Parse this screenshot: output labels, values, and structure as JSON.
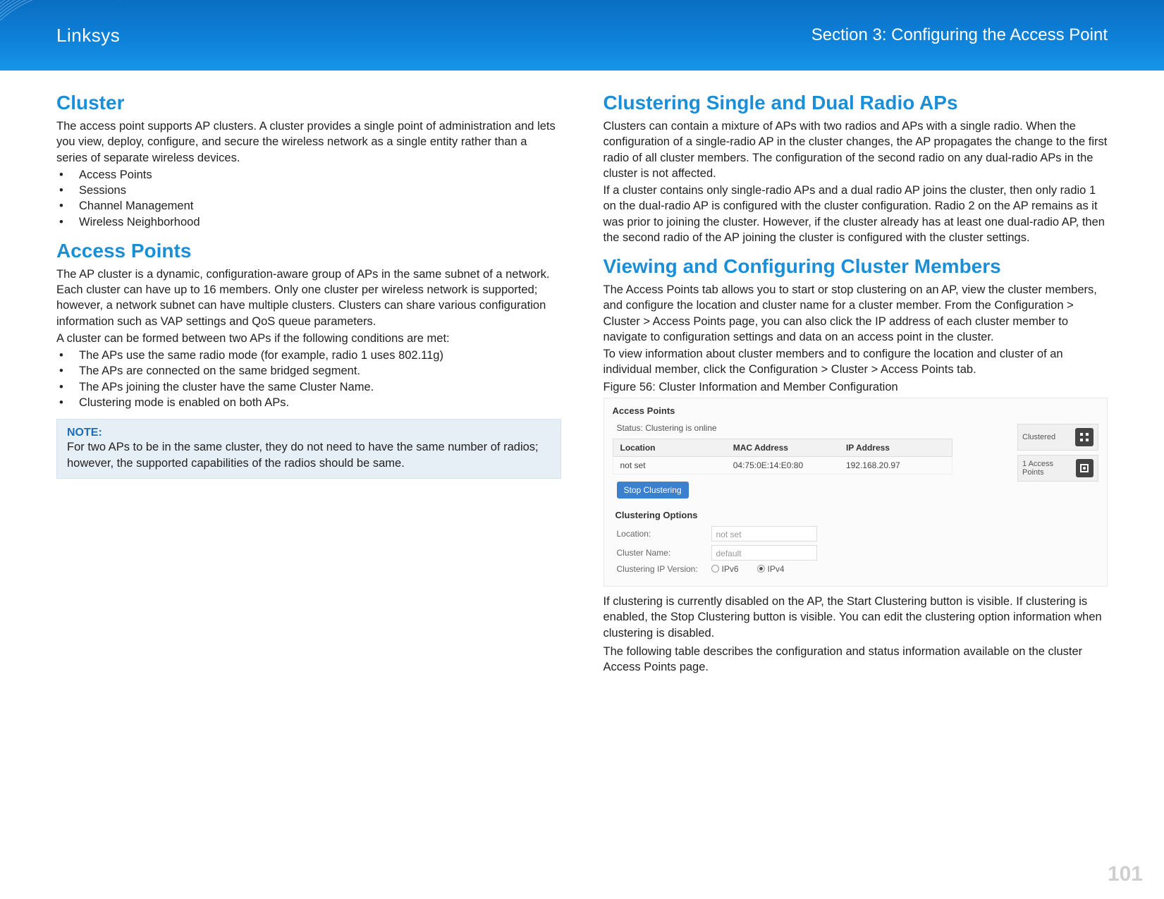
{
  "header": {
    "brand": "Linksys",
    "section": "Section 3:  Configuring the Access Point"
  },
  "page_number": "101",
  "left": {
    "h_cluster": "Cluster",
    "p_cluster": "The access point supports AP clusters. A cluster provides a single point of administration and lets you view, deploy, configure, and secure the wireless network as a single entity rather than a series of separate wireless devices.",
    "cluster_list": [
      "Access Points",
      "Sessions",
      "Channel Management",
      "Wireless Neighborhood"
    ],
    "h_ap": "Access Points",
    "p_ap1": "The AP cluster is a dynamic, configuration-aware group of APs in the same subnet of a network. Each cluster can have up to 16 members. Only one cluster per wireless network is supported; however, a network subnet can have multiple clusters. Clusters can share various configuration information such as VAP settings and QoS queue parameters.",
    "p_ap2": "A cluster can be formed between two APs if the following conditions are met:",
    "ap_list": [
      "The APs use the same radio mode (for example, radio 1 uses 802.11g)",
      "The APs are connected on the same bridged segment.",
      "The APs joining the cluster have the same Cluster Name.",
      "Clustering mode is enabled on both APs."
    ],
    "note_label": "NOTE:",
    "note_body": "For two APs to be in the same cluster, they do not need to have the same number of radios; however, the supported capabilities of the radios should be same."
  },
  "right": {
    "h_single": "Clustering Single and Dual Radio APs",
    "p_single1": "Clusters can contain a mixture of APs with two radios and APs with a single radio. When the configuration of a single-radio AP in the cluster changes, the AP propagates the change to the first radio of all cluster members. The configuration of the second radio on any dual-radio APs in the cluster is not affected.",
    "p_single2": "If a cluster contains only single-radio APs and a dual radio AP joins the cluster, then only radio 1 on the dual-radio AP is configured with the cluster configuration. Radio 2 on the AP remains as it was prior to joining the cluster. However, if the cluster already has at least one dual-radio AP, then the second radio of the AP joining the cluster is configured with the cluster settings.",
    "h_view": "Viewing and Configuring Cluster Members",
    "p_view1": "The Access Points tab allows you to start or stop clustering on an AP, view the cluster members, and configure the location and cluster name for a cluster member. From the Configuration > Cluster > Access Points page, you can also click the IP address of each cluster member to navigate to configuration settings and data on an access point in the cluster.",
    "p_view2": "To view information about cluster members and to configure the location and cluster of an individual member, click the Configuration > Cluster > Access Points tab.",
    "fig_caption": "Figure 56: Cluster Information and Member Configuration",
    "p_after1": "If clustering is currently disabled on the AP, the Start Clustering button is visible. If clustering is enabled, the Stop Clustering button is visible. You can edit the clustering option information when clustering is disabled.",
    "p_after2": "The following table describes the configuration and status information available on the cluster Access Points page."
  },
  "screenshot": {
    "title": "Access Points",
    "status": "Status: Clustering is online",
    "th_location": "Location",
    "th_mac": "MAC Address",
    "th_ip": "IP Address",
    "row_location": "not set",
    "row_mac": "04:75:0E:14:E0:80",
    "row_ip": "192.168.20.97",
    "btn_stop": "Stop Clustering",
    "sub_options": "Clustering Options",
    "lbl_location": "Location:",
    "ph_location": "not set",
    "lbl_cluster": "Cluster Name:",
    "ph_cluster": "default",
    "lbl_ipver": "Clustering IP Version:",
    "radio_ipv6": "IPv6",
    "radio_ipv4": "IPv4",
    "tile_clustered": "Clustered",
    "tile_count_label": "1 Access Points",
    "tile_count_glyph": "⬚"
  }
}
